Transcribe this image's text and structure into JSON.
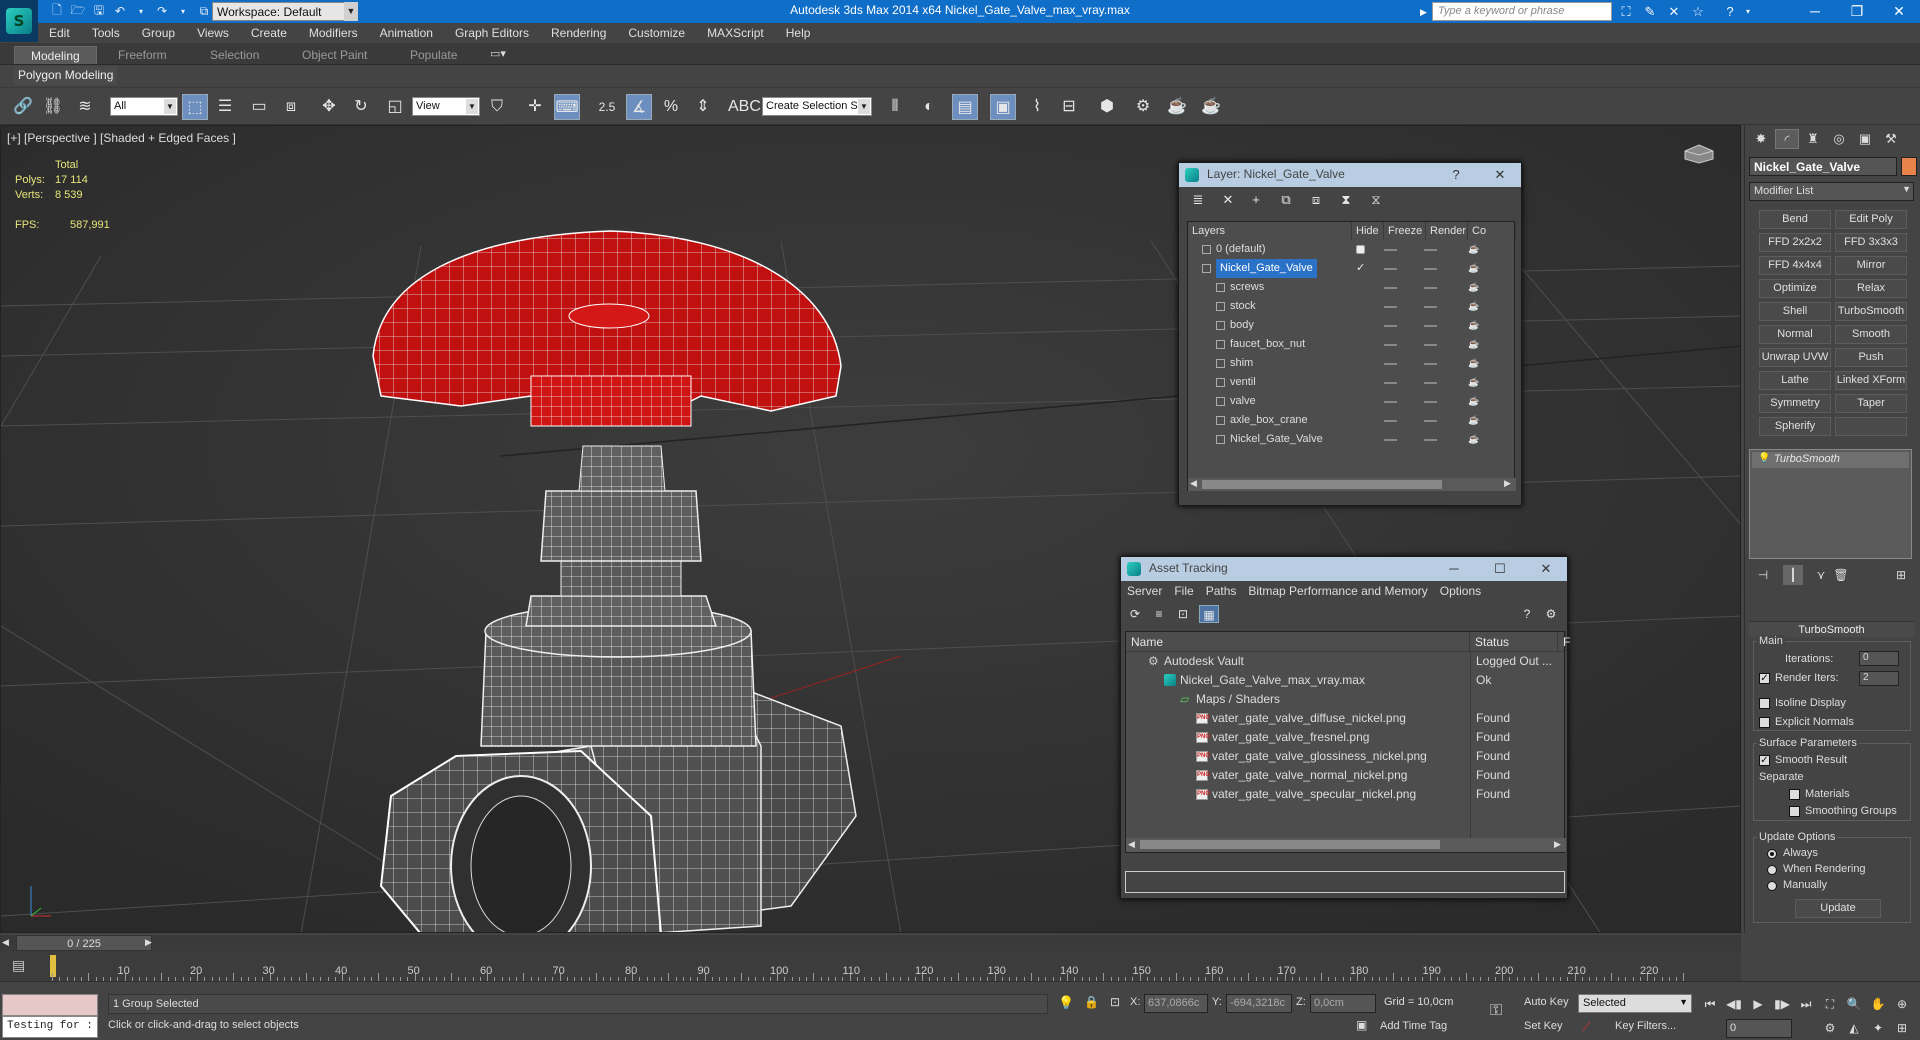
{
  "titlebar": {
    "workspace": "Workspace: Default",
    "title": "Autodesk 3ds Max  2014 x64      Nickel_Gate_Valve_max_vray.max",
    "search_placeholder": "Type a keyword or phrase"
  },
  "menu": [
    "Edit",
    "Tools",
    "Group",
    "Views",
    "Create",
    "Modifiers",
    "Animation",
    "Graph Editors",
    "Rendering",
    "Customize",
    "MAXScript",
    "Help"
  ],
  "ribbon": {
    "tabs": [
      "Modeling",
      "Freeform",
      "Selection",
      "Object Paint",
      "Populate"
    ],
    "active": "Modeling",
    "panel": "Polygon Modeling"
  },
  "toolbar": {
    "filter": "All",
    "refcoord": "View",
    "snap_label": "2.5",
    "selset_placeholder": "Create Selection Se"
  },
  "viewport": {
    "label": "[+] [Perspective ] [Shaded + Edged Faces ]",
    "stats": {
      "header": "Total",
      "polys_label": "Polys:",
      "polys": "17 114",
      "verts_label": "Verts:",
      "verts": "8 539",
      "fps_label": "FPS:",
      "fps": "587,991"
    }
  },
  "layer_window": {
    "title": "Layer: Nickel_Gate_Valve",
    "help": "?",
    "columns": [
      "Layers",
      "Hide",
      "Freeze",
      "Render",
      "Co"
    ],
    "layers": [
      {
        "name": "0 (default)",
        "level": 0
      },
      {
        "name": "Nickel_Gate_Valve",
        "level": 0,
        "selected": true
      },
      {
        "name": "screws",
        "level": 1
      },
      {
        "name": "stock",
        "level": 1
      },
      {
        "name": "body",
        "level": 1
      },
      {
        "name": "faucet_box_nut",
        "level": 1
      },
      {
        "name": "shim",
        "level": 1
      },
      {
        "name": "ventil",
        "level": 1
      },
      {
        "name": "valve",
        "level": 1
      },
      {
        "name": "axle_box_crane",
        "level": 1
      },
      {
        "name": "Nickel_Gate_Valve",
        "level": 1
      }
    ]
  },
  "asset_window": {
    "title": "Asset Tracking",
    "menu": [
      "Server",
      "File",
      "Paths",
      "Bitmap Performance and Memory",
      "Options"
    ],
    "columns": [
      "Name",
      "Status",
      "F"
    ],
    "rows": [
      {
        "name": "Autodesk Vault",
        "status": "Logged Out ...",
        "level": 0,
        "icon": "vault"
      },
      {
        "name": "Nickel_Gate_Valve_max_vray.max",
        "status": "Ok",
        "level": 1,
        "icon": "max"
      },
      {
        "name": "Maps / Shaders",
        "status": "",
        "level": 2,
        "icon": "maps"
      },
      {
        "name": "vater_gate_valve_diffuse_nickel.png",
        "status": "Found",
        "level": 3,
        "icon": "png"
      },
      {
        "name": "vater_gate_valve_fresnel.png",
        "status": "Found",
        "level": 3,
        "icon": "png"
      },
      {
        "name": "vater_gate_valve_glossiness_nickel.png",
        "status": "Found",
        "level": 3,
        "icon": "png"
      },
      {
        "name": "vater_gate_valve_normal_nickel.png",
        "status": "Found",
        "level": 3,
        "icon": "png"
      },
      {
        "name": "vater_gate_valve_specular_nickel.png",
        "status": "Found",
        "level": 3,
        "icon": "png"
      }
    ]
  },
  "command_panel": {
    "object_name": "Nickel_Gate_Valve",
    "object_color": "#e8834a",
    "modifier_list": "Modifier List",
    "modifier_buttons": [
      "Bend",
      "Edit Poly",
      "FFD 2x2x2",
      "FFD 3x3x3",
      "FFD 4x4x4",
      "Mirror",
      "Optimize",
      "Relax",
      "Shell",
      "TurboSmooth",
      "Normal",
      "Smooth",
      "Unwrap UVW",
      "Push",
      "Lathe",
      "Linked XForm",
      "Symmetry",
      "Taper",
      "Spherify",
      ""
    ],
    "stack_item": "TurboSmooth",
    "rollout": {
      "title": "TurboSmooth",
      "main": "Main",
      "iterations_label": "Iterations:",
      "iterations": "0",
      "render_iters_label": "Render Iters:",
      "render_iters": "2",
      "isoline": "Isoline Display",
      "explicit": "Explicit Normals",
      "surface": "Surface Parameters",
      "smooth_result": "Smooth Result",
      "separate": "Separate",
      "materials": "Materials",
      "smoothing_groups": "Smoothing Groups",
      "update_options": "Update Options",
      "always": "Always",
      "when_rendering": "When Rendering",
      "manually": "Manually",
      "update": "Update"
    }
  },
  "timeline": {
    "frame": "0 / 225",
    "ticks": [
      10,
      20,
      30,
      40,
      50,
      60,
      70,
      80,
      90,
      100,
      110,
      120,
      130,
      140,
      150,
      160,
      170,
      180,
      190,
      200,
      210,
      220
    ]
  },
  "status": {
    "listener": "Testing for :",
    "selection": "1 Group Selected",
    "prompt": "Click or click-and-drag to select objects",
    "x_label": "X:",
    "x": "637,0866c",
    "y_label": "Y:",
    "y": "-694,3218c",
    "z_label": "Z:",
    "z": "0,0cm",
    "grid": "Grid = 10,0cm",
    "auto_key": "Auto Key",
    "key_mode": "Selected",
    "set_key": "Set Key",
    "key_filters": "Key Filters...",
    "add_time_tag": "Add Time Tag",
    "frame_value": "0"
  }
}
